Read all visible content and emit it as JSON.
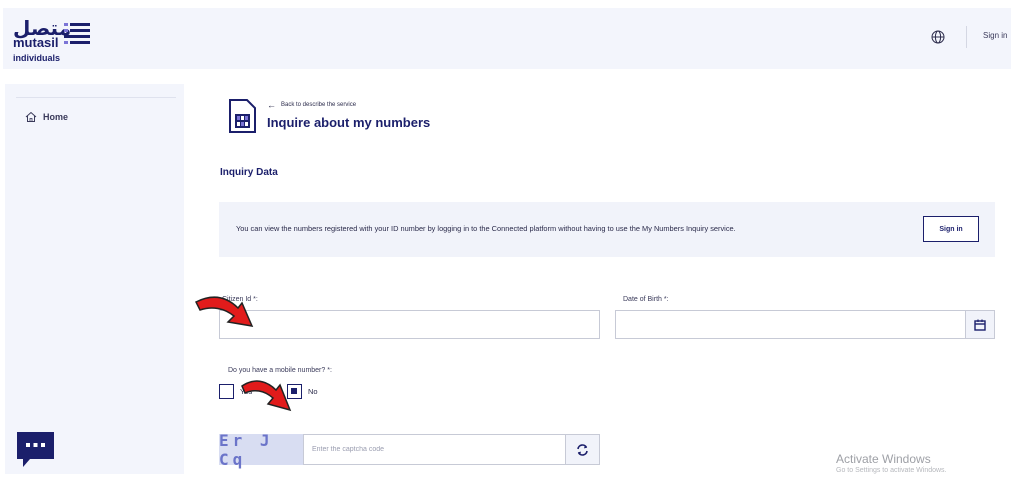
{
  "header": {
    "logo_arabic": "متصل",
    "logo_word": "mutasil",
    "logo_sub": "individuals",
    "sign_in_label": "Sign in"
  },
  "sidebar": {
    "items": [
      {
        "label": "Home",
        "icon": "home-icon"
      }
    ]
  },
  "main": {
    "back_link": "Back to describe the service",
    "page_title": "Inquire about my numbers",
    "section_title": "Inquiry Data",
    "info_text": "You can view the numbers registered with your ID number by logging in to the Connected platform without having to use the My Numbers Inquiry service.",
    "info_sign_in": "Sign in",
    "citizen_id_label": "Citizen Id *:",
    "citizen_id_value": "",
    "dob_label": "Date of Birth *:",
    "dob_value": "",
    "mobile_question": "Do you have a mobile number? *:",
    "option_yes": "Yes",
    "option_no": "No",
    "selected_option": "No",
    "captcha_text": "Er J Cq",
    "captcha_placeholder": "Enter the captcha code"
  },
  "watermark": {
    "title": "Activate Windows",
    "subtitle": "Go to Settings to activate Windows."
  },
  "colors": {
    "brand": "#1b1f6b",
    "accent": "#7b74d6",
    "annotation_arrow": "#e11b1b"
  }
}
